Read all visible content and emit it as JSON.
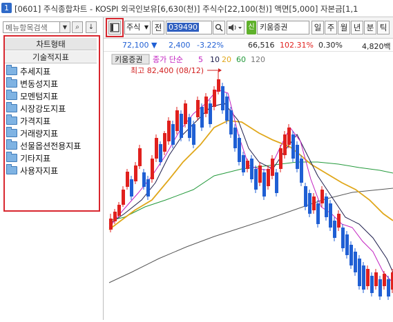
{
  "window": {
    "number": "1",
    "title": "[0601] 주식종합차트 - KOSPI 외국인보유[6,630(천)] 주식수[22,100(천)] 액면[5,000] 자본금[1,1"
  },
  "sidebar": {
    "search_placeholder": "메뉴항목검색",
    "dropdown_glyph": "▼",
    "search_glyph": "⌕",
    "down_glyph": "↓",
    "tabs": [
      "차트형태",
      "기술적지표"
    ],
    "items": [
      "추세지표",
      "변동성지표",
      "모멘텀지표",
      "시장강도지표",
      "가격지표",
      "거래량지표",
      "선물옵션전용지표",
      "기타지표",
      "사용자지표"
    ]
  },
  "toolbar": {
    "market_type": "주식",
    "all_button": "전",
    "code": "039490",
    "company": "키움증권",
    "credit_badge": "신",
    "period_buttons": [
      "일",
      "주",
      "월",
      "년",
      "분",
      "틱"
    ]
  },
  "price": {
    "current": "72,100",
    "direction": "▼",
    "change": "2,400",
    "change_pct": "-3.22%",
    "volume": "66,516",
    "volume_ratio": "102.31%",
    "turnover": "0.30%",
    "amount": "4,820백"
  },
  "chart": {
    "legend": {
      "name": "키움증권",
      "series": "종가 단순",
      "periods": [
        "5",
        "10",
        "20",
        "60",
        "120"
      ]
    },
    "high_annotation": "최고 82,400 (08/12)",
    "colors": {
      "up": "#e0201d",
      "down": "#1f5fd4",
      "ma5": "#c21fc0",
      "ma10": "#1b1b4a",
      "ma20": "#e0a71a",
      "ma60": "#22993a",
      "ma120": "#555555",
      "highlight": "#d8262e"
    }
  }
}
